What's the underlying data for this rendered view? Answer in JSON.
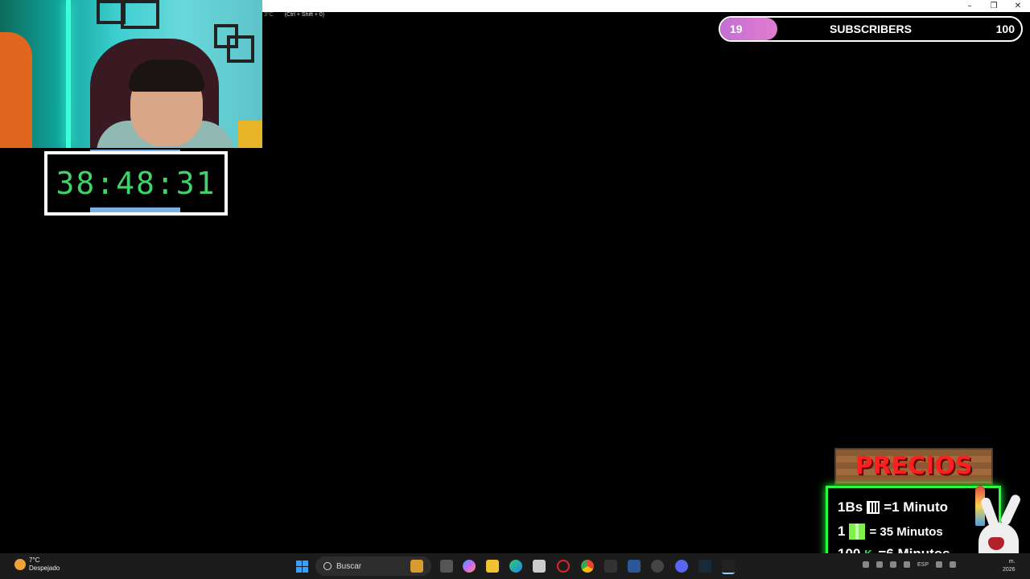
{
  "window": {
    "controls": {
      "minimize": "–",
      "maximize": "❐",
      "close": "✕"
    }
  },
  "hotkey_hint": {
    "temp": "3°C",
    "shortcut": "(Ctrl + Shift + 0)"
  },
  "timer": {
    "value": "38:48:31",
    "color": "#3ed46a"
  },
  "subscriber_goal": {
    "current": "19",
    "label": "SUBSCRIBERS",
    "goal": "100",
    "progress": 0.19
  },
  "prices": {
    "title": "PRECIOS",
    "rows": [
      {
        "left": "1Bs",
        "right": "=1 Minuto"
      },
      {
        "left": "1",
        "right": "= 35 Minutos"
      },
      {
        "left": "100",
        "right": "=6 Minutos"
      }
    ]
  },
  "taskbar": {
    "weather": {
      "temp": "7°C",
      "condition": "Despejado"
    },
    "search_placeholder": "Buscar",
    "tray_lang": "ESP",
    "clock": {
      "line1": "m.",
      "line2": "2026"
    },
    "icons": [
      "weather-icon",
      "start-icon",
      "search-icon",
      "crown-app-icon",
      "taskview-icon",
      "copilot-icon",
      "file-explorer-icon",
      "edge-icon",
      "store-icon",
      "opera-icon",
      "chrome-icon",
      "capcut-icon",
      "word-icon",
      "steam-like-icon",
      "discord-icon",
      "steam-icon",
      "obs-icon"
    ]
  }
}
